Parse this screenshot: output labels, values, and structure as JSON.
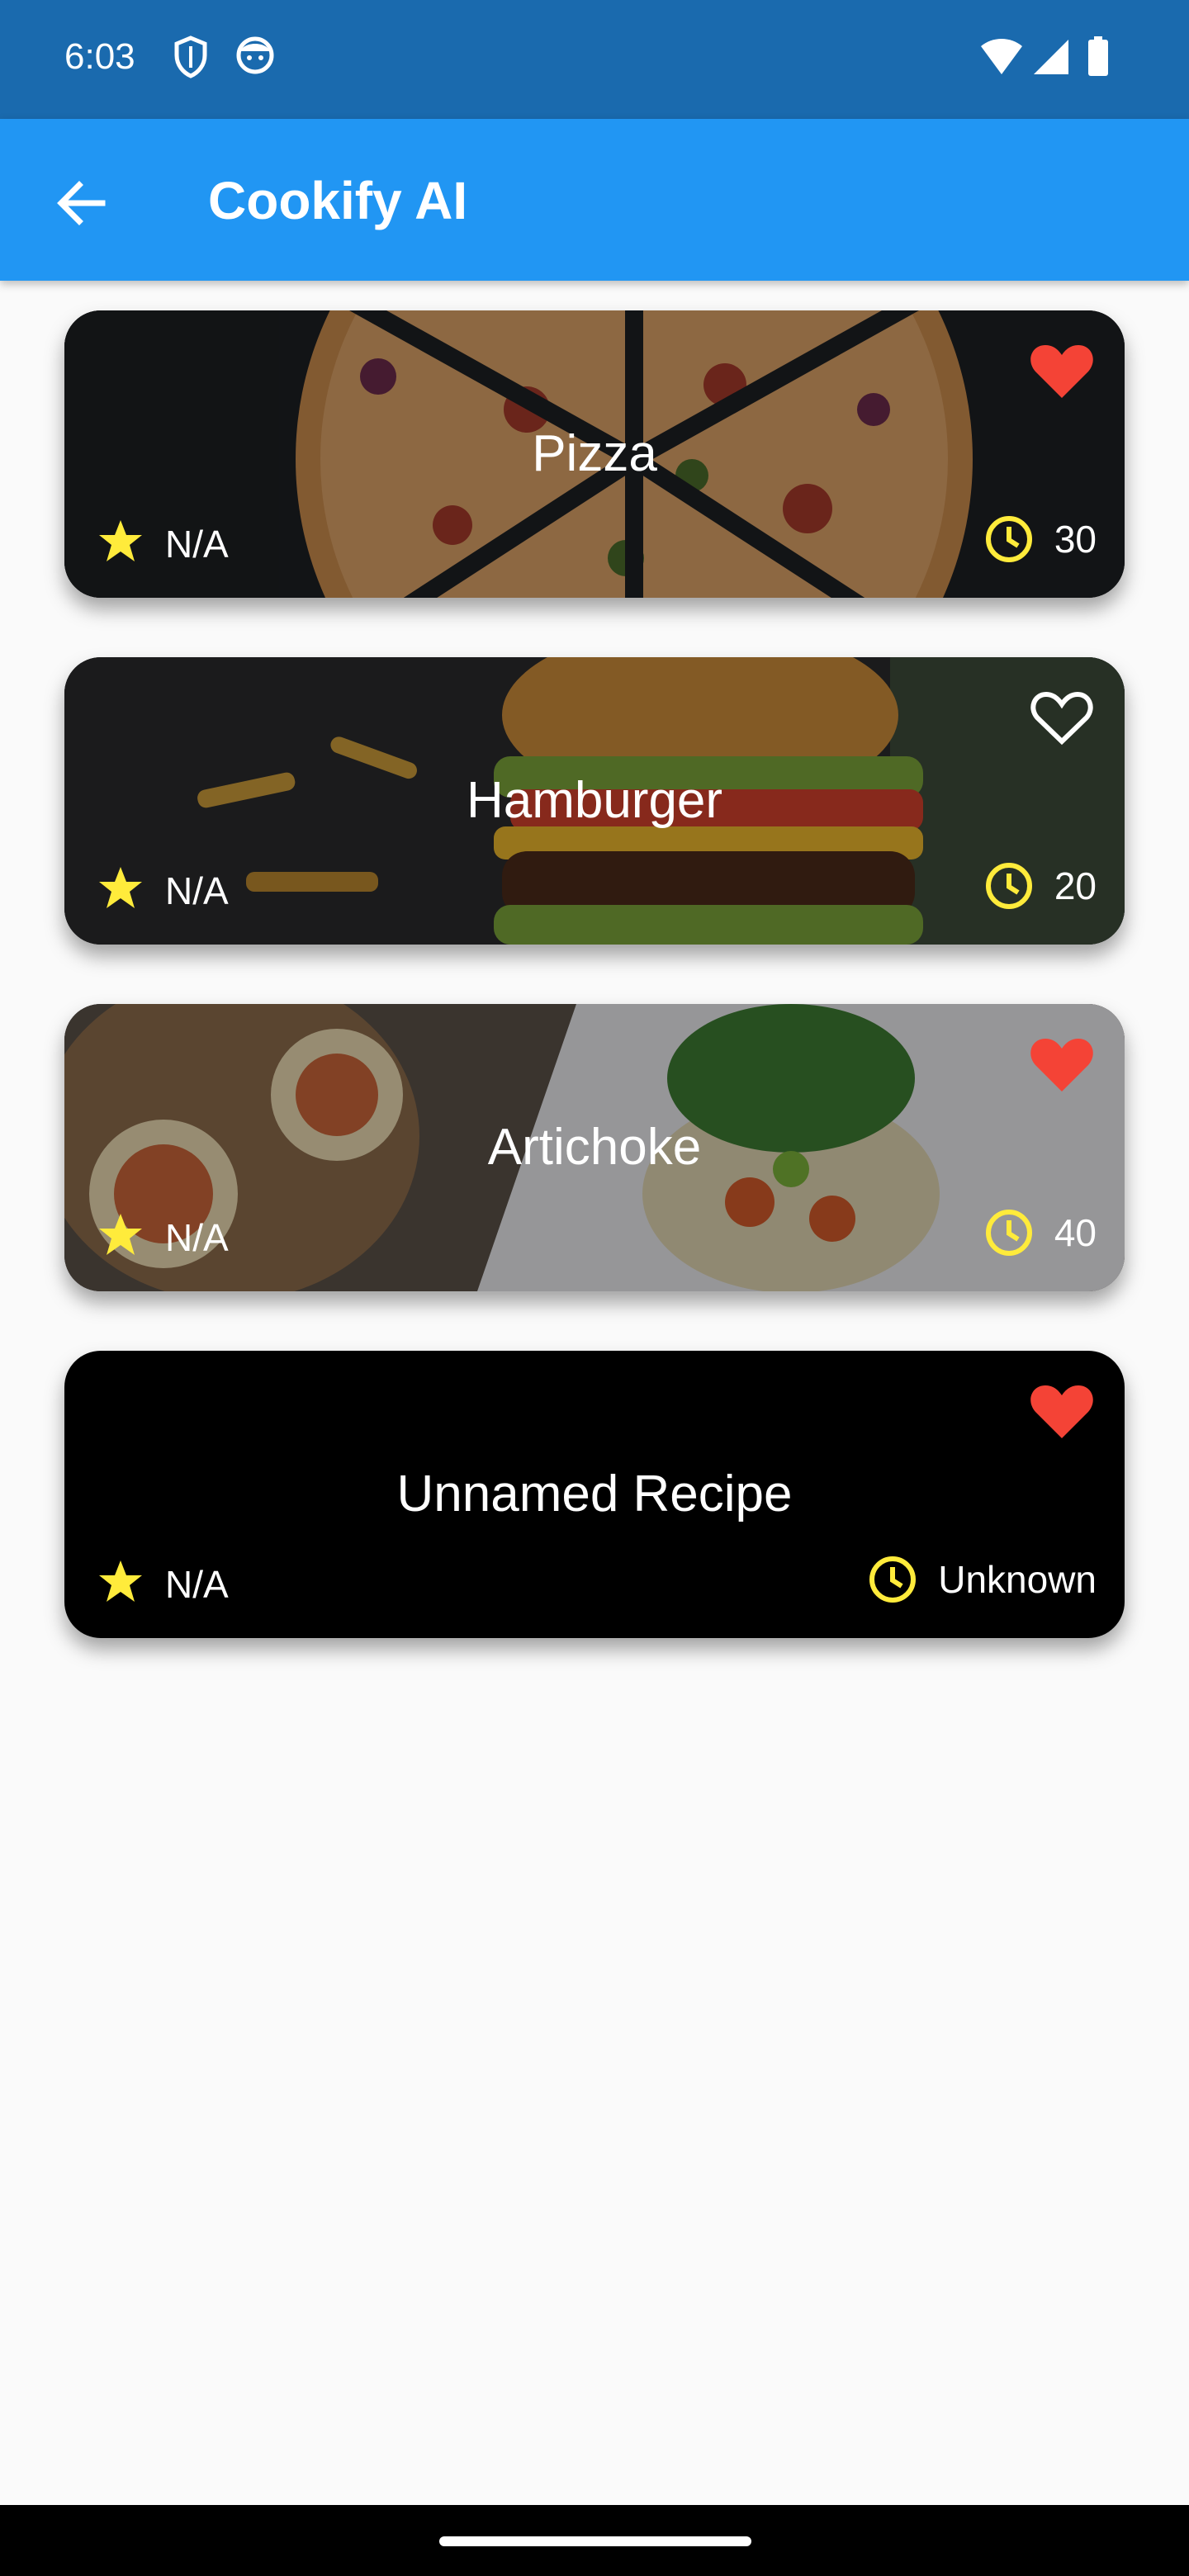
{
  "status_bar": {
    "time": "6:03"
  },
  "app_bar": {
    "title": "Cookify AI"
  },
  "recipes": [
    {
      "name": "Pizza",
      "rating": "N/A",
      "time": "30",
      "favorite": true
    },
    {
      "name": "Hamburger",
      "rating": "N/A",
      "time": "20",
      "favorite": false
    },
    {
      "name": "Artichoke",
      "rating": "N/A",
      "time": "40",
      "favorite": true
    },
    {
      "name": "Unnamed Recipe",
      "rating": "N/A",
      "time": "Unknown",
      "favorite": true
    }
  ],
  "colors": {
    "status_bar": "#1a6aae",
    "app_bar": "#2196f3",
    "favorite": "#f44336",
    "accent_yellow": "#ffeb3b",
    "background": "#fafafa"
  },
  "icons": {
    "back": "arrow-back-icon",
    "favorite_on": "heart-filled-icon",
    "favorite_off": "heart-outline-icon",
    "rating": "star-icon",
    "time": "clock-icon"
  }
}
